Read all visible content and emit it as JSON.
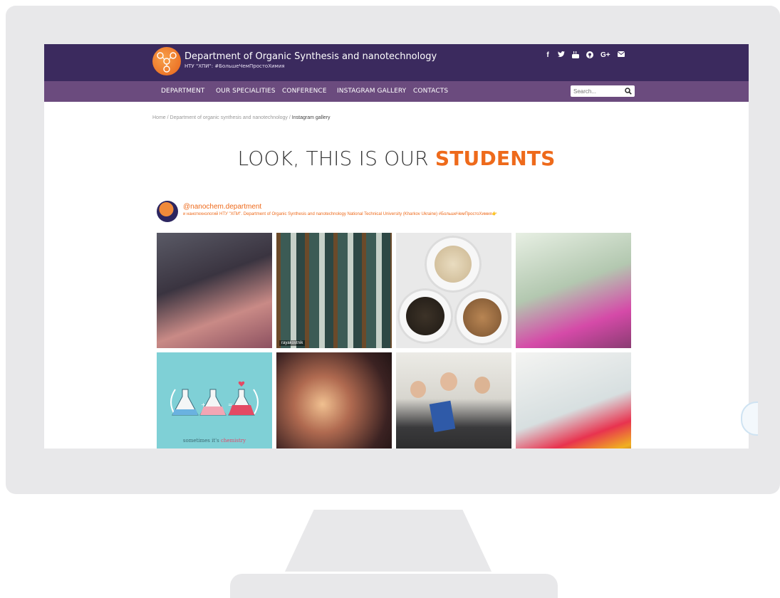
{
  "header": {
    "title": "Department of Organic Synthesis and nanotechnology",
    "subtitle": "НТУ \"ХПИ\": #БольшеЧемПростоХимия",
    "social": [
      {
        "icon": "facebook-icon",
        "glyph": "f"
      },
      {
        "icon": "twitter-icon",
        "glyph": "🐦"
      },
      {
        "icon": "youtube-icon",
        "glyph": "▶"
      },
      {
        "icon": "pinterest-icon",
        "glyph": "P"
      },
      {
        "icon": "google-plus-icon",
        "glyph": "G+"
      },
      {
        "icon": "mail-icon",
        "glyph": "✉"
      }
    ]
  },
  "nav": {
    "items": [
      "DEPARTMENT",
      "OUR SPECIALITIES",
      "CONFERENCE",
      "INSTAGRAM GALLERY",
      "CONTACTS"
    ],
    "search_placeholder": "Search..."
  },
  "breadcrumb": {
    "home": "Home",
    "sep": "/",
    "parent": "Department of organic synthesis and nanotechnology",
    "current": "Instagram gallery"
  },
  "headline": {
    "prefix": "LOOK, THIS IS OUR ",
    "accent": "STUDENTS"
  },
  "profile": {
    "handle": "@nanochem.department",
    "bio": "и нанотехнологий НТУ \"ХПИ\". Department of Organic Synthesis and nanotechnology National Technical University (Kharkov Ukraine) #БольшеЧемПростоХимия👉"
  },
  "gallery": {
    "tile2_caption": "rayakostnik",
    "tile5_caption": "sometimes it's",
    "tile5_caption_accent": "chemistry"
  },
  "colors": {
    "header_bg": "#3b2a5e",
    "nav_bg": "#6b4b7e",
    "accent": "#ee6a1b"
  }
}
